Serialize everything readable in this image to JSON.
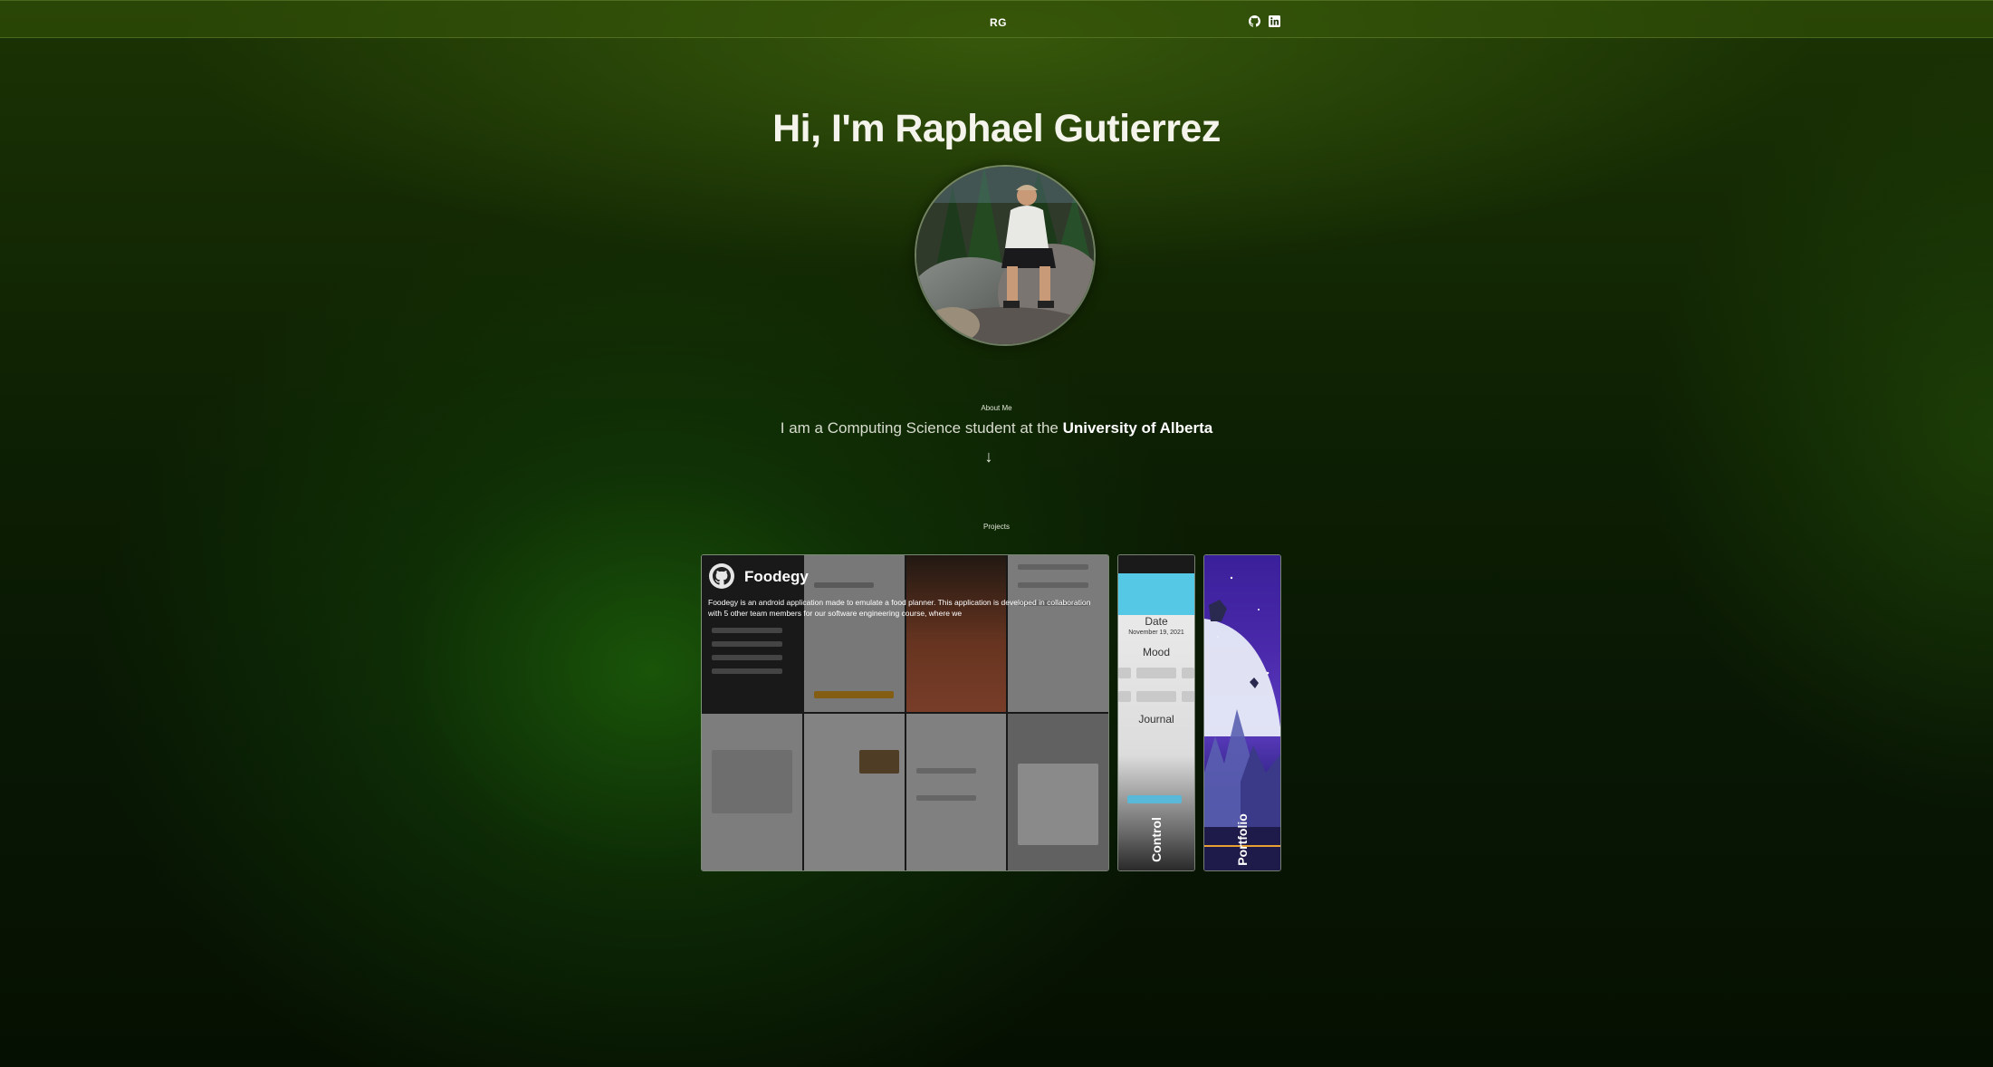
{
  "header": {
    "logo": "RG",
    "github_icon": "github-icon",
    "linkedin_icon": "linkedin-icon"
  },
  "hero": {
    "title": "Hi, I'm Raphael Gutierrez",
    "avatar_icon": "profile-photo"
  },
  "about": {
    "label": "About Me",
    "text_prefix": "I am a Computing Science student at the ",
    "text_emphasis": "University of Alberta",
    "arrow": "↓"
  },
  "projects": {
    "label": "Projects",
    "items": [
      {
        "title": "Foodegy",
        "description": "Foodegy is an android application made to emulate a food planner. This application is developed in collaboration with 5 other team members for our software engineering course, where we",
        "icon": "github-icon"
      },
      {
        "title": "Control",
        "screen_date_label": "Date",
        "screen_date_value": "November 19, 2021",
        "screen_mood_label": "Mood",
        "screen_journal_label": "Journal"
      },
      {
        "title": "Portfolio"
      }
    ]
  },
  "colors": {
    "background": "#0c1e03",
    "accent_green": "#2a6a0c",
    "text": "#f4f4ec"
  }
}
